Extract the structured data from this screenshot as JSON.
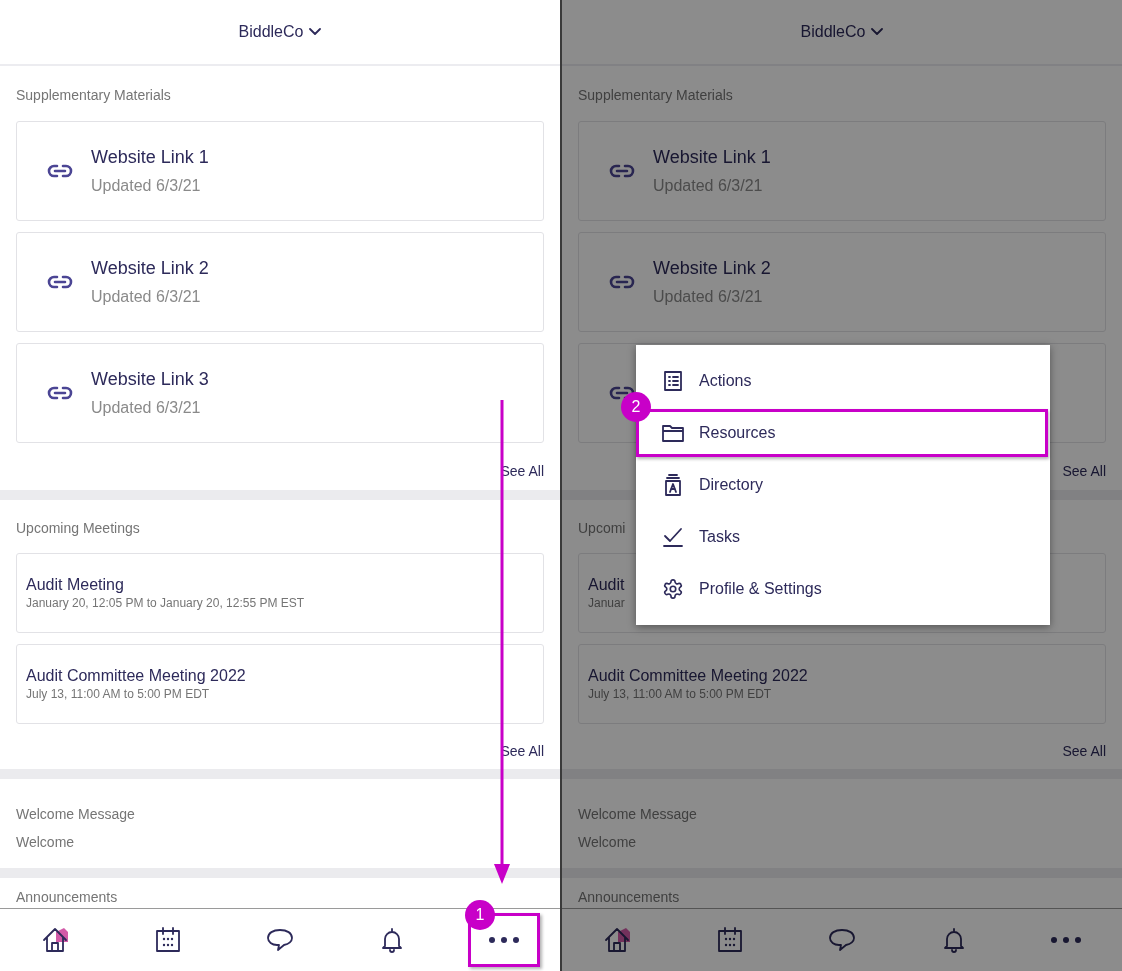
{
  "panels": [
    {
      "header": {
        "title": "BiddleCo"
      },
      "scroll_arrow": true,
      "sections": [
        {
          "kind": "links",
          "label": "Supplementary Materials",
          "items": [
            {
              "kind": "full",
              "title": "Website Link 1",
              "subtitle": "Updated 6/3/21"
            },
            {
              "kind": "full",
              "title": "Website Link 2",
              "subtitle": "Updated 6/3/21"
            },
            {
              "kind": "full",
              "title": "Website Link 3",
              "subtitle": "Updated 6/3/21"
            }
          ],
          "see_all": "See All"
        },
        {
          "kind": "meetings",
          "label": "Upcoming Meetings",
          "items": [
            {
              "title": "Audit Meeting",
              "subtitle": "January 20, 12:05 PM to January 20, 12:55 PM EST"
            },
            {
              "title": "Audit Committee Meeting 2022",
              "subtitle": "July 13, 11:00 AM to 5:00 PM EDT"
            }
          ],
          "see_all": "See All"
        },
        {
          "kind": "message",
          "label": "Welcome Message",
          "body": "Welcome"
        },
        {
          "kind": "heading",
          "label": "Announcements"
        }
      ],
      "nav": [
        {
          "kind": "home",
          "selected": true
        },
        {
          "kind": "calendar",
          "selected": false
        },
        {
          "kind": "chat",
          "selected": false
        },
        {
          "kind": "bell",
          "selected": false
        },
        {
          "kind": "more",
          "selected": false,
          "callout": "1"
        }
      ]
    },
    {
      "header": {
        "title": "BiddleCo"
      },
      "dimmed": true,
      "sections": [
        {
          "kind": "links",
          "label": "Supplementary Materials",
          "items": [
            {
              "kind": "full",
              "title": "Website Link 1",
              "subtitle": "Updated 6/3/21"
            },
            {
              "kind": "full",
              "title": "Website Link 2",
              "subtitle": "Updated 6/3/21"
            },
            {
              "kind": "icon_only"
            }
          ],
          "see_all": "See All"
        },
        {
          "kind": "meetings",
          "label": "Upcomi",
          "items": [
            {
              "title": "Audit",
              "subtitle": "Januar"
            },
            {
              "title": "Audit Committee Meeting 2022",
              "subtitle": "July 13, 11:00 AM to 5:00 PM EDT"
            }
          ],
          "see_all": "See All"
        },
        {
          "kind": "message",
          "label": "Welcome Message",
          "body": "Welcome"
        },
        {
          "kind": "heading",
          "label": "Announcements"
        }
      ],
      "nav": [
        {
          "kind": "home",
          "selected": true
        },
        {
          "kind": "calendar",
          "selected": false
        },
        {
          "kind": "chat",
          "selected": false
        },
        {
          "kind": "bell",
          "selected": false
        },
        {
          "kind": "more",
          "selected": false
        }
      ],
      "menu": {
        "items": [
          {
            "kind": "list",
            "label": "Actions",
            "selected": false
          },
          {
            "kind": "folder",
            "label": "Resources",
            "selected": true,
            "callout": "2"
          },
          {
            "kind": "contacts",
            "label": "Directory",
            "selected": false
          },
          {
            "kind": "check",
            "label": "Tasks",
            "selected": false
          },
          {
            "kind": "gear",
            "label": "Profile & Settings",
            "selected": false
          }
        ]
      }
    }
  ]
}
